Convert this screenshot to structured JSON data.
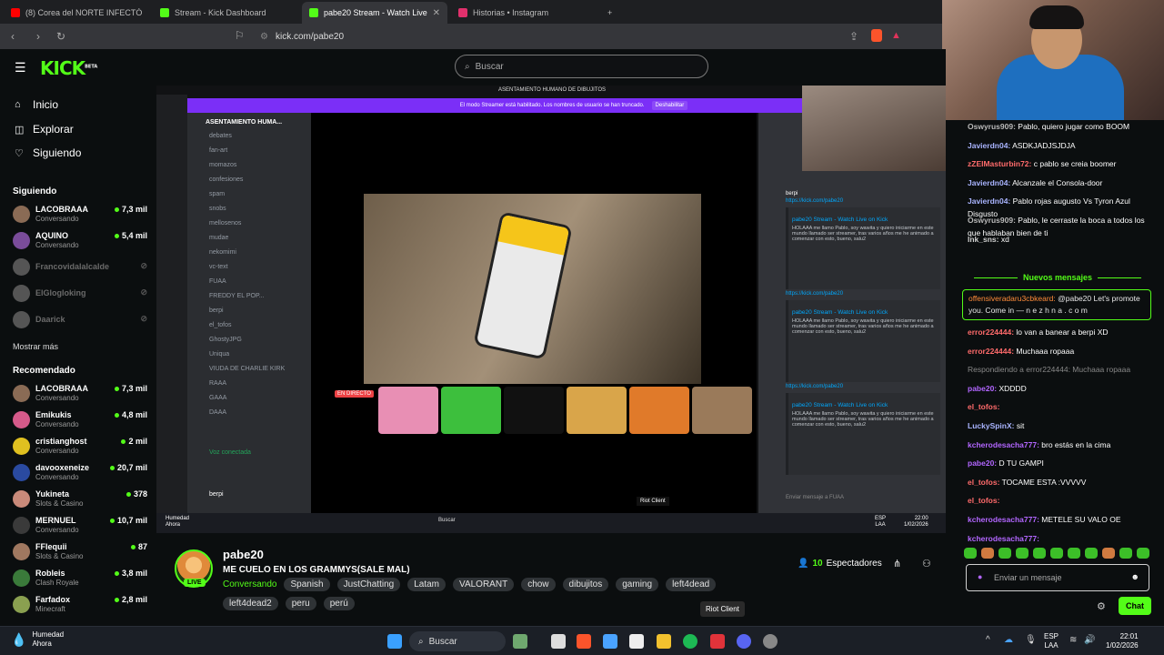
{
  "browser": {
    "tabs": [
      {
        "label": "(8) Corea del NORTE INFECTÓ Play St",
        "color": "#ff0000"
      },
      {
        "label": "Stream - Kick Dashboard",
        "color": "#53fc18"
      },
      {
        "label": "pabe20 Stream - Watch Live o",
        "color": "#53fc18"
      },
      {
        "label": "Historias • Instagram",
        "color": "#e1306c"
      }
    ],
    "new_tab": "+",
    "url": "kick.com/pabe20"
  },
  "kick": {
    "logo": "KICK",
    "logo_beta": "BETA",
    "search_placeholder": "Buscar",
    "nav": [
      {
        "label": "Inicio",
        "icon": "home-icon"
      },
      {
        "label": "Explorar",
        "icon": "compass-icon"
      },
      {
        "label": "Siguiendo",
        "icon": "heart-icon"
      }
    ],
    "following_header": "Siguiendo",
    "following": [
      {
        "name": "LACOBRAAA",
        "category": "Conversando",
        "viewers": "7,3 mil",
        "color": "#8a6b55"
      },
      {
        "name": "AQUINO",
        "category": "Conversando",
        "viewers": "5,4 mil",
        "color": "#7a4c9a"
      },
      {
        "name": "Francovidalalcalde",
        "category": "",
        "viewers": "",
        "color": "#555"
      },
      {
        "name": "ElGlogloking",
        "category": "",
        "viewers": "",
        "color": "#555"
      },
      {
        "name": "Daarick",
        "category": "",
        "viewers": "",
        "color": "#555"
      }
    ],
    "show_more": "Mostrar más",
    "recommended_header": "Recomendado",
    "recommended": [
      {
        "name": "LACOBRAAA",
        "category": "Conversando",
        "viewers": "7,3 mil",
        "color": "#8a6b55"
      },
      {
        "name": "Emikukis",
        "category": "Conversando",
        "viewers": "4,8 mil",
        "color": "#d65a8a"
      },
      {
        "name": "cristianghost",
        "category": "Conversando",
        "viewers": "2 mil",
        "color": "#e0c020"
      },
      {
        "name": "davooxeneize",
        "category": "Conversando",
        "viewers": "20,7 mil",
        "color": "#2a4aa0"
      },
      {
        "name": "Yukineta",
        "category": "Slots & Casino",
        "viewers": "378",
        "color": "#c98a7a"
      },
      {
        "name": "MERNUEL",
        "category": "Conversando",
        "viewers": "10,7 mil",
        "color": "#3a3a3a"
      },
      {
        "name": "FFlequii",
        "category": "Slots & Casino",
        "viewers": "87",
        "color": "#a07860"
      },
      {
        "name": "Robleis",
        "category": "Clash Royale",
        "viewers": "3,8 mil",
        "color": "#3a7a3a"
      },
      {
        "name": "Farfadox",
        "category": "Minecraft",
        "viewers": "2,8 mil",
        "color": "#8aa050"
      }
    ]
  },
  "discord": {
    "banner_title": "ASENTAMIENTO HUMANO DE DIBUJITOS",
    "banner_text": "El modo Streamer está habilitado. Los nombres de usuario se han truncado.",
    "banner_btn": "Deshabilitar",
    "server_name": "ASENTAMIENTO HUMA...",
    "channels": [
      "debates",
      "fan-art",
      "momazos",
      "confesiones",
      "spam",
      "snobs",
      "mellosenos",
      "mudae",
      "nekomimi",
      "vc-text",
      "FUAA",
      "FREDDY EL POP...",
      "berpi",
      "el_tofos",
      "GhostyJPG",
      "Uniqua",
      "VIUDA DE CHARLIE KIRK",
      "RAAA",
      "GAAA",
      "DAAA"
    ],
    "live_label": "EN DIRECTO",
    "voice_connected": "Voz conectada",
    "user": "berpi",
    "chat_channel": "FUAA",
    "embed_author": "berpi",
    "embed_link": "https://kick.com/pabe20",
    "embed_title": "pabe20 Stream - Watch Live on Kick",
    "embed_text": "HOLAAA me llamo Pablo, soy wawita y quiero iniciarme en este mundo llamado ser streamer, tras varios años me he animado a comenzar con esto, bueno, salu2",
    "input_placeholder": "Enviar mensaje a FUAA",
    "tooltip": "Riot Client",
    "taskbar_search": "Buscar",
    "weather_title": "Humedad",
    "weather_sub": "Ahora",
    "lang": "ESP",
    "lang2": "LAA",
    "time": "22:00",
    "date": "1/02/2026"
  },
  "stream": {
    "streamer": "pabe20",
    "live_badge": "LIVE",
    "title": "ME CUELO EN LOS GRAMMYS(SALE MAL)",
    "category": "Conversando",
    "tags": [
      "Spanish",
      "JustChatting",
      "Latam",
      "VALORANT",
      "chow",
      "dibujitos",
      "gaming",
      "left4dead",
      "left4dead2",
      "peru",
      "perú"
    ],
    "viewer_count": "10",
    "viewer_label": "Espectadores",
    "tooltip": "Riot Client"
  },
  "chat": {
    "messages": [
      {
        "user": "Oswyrus909:",
        "text": " Pablo, quiero jugar como BOOM",
        "color": "#b9b9b9"
      },
      {
        "user": "Javierdn04:",
        "text": " ASDKJADJSJDJA",
        "color": "#a9b4ff"
      },
      {
        "user": "zZEIMasturbin72:",
        "text": " c pablo se creia boomer",
        "color": "#ff6b6b"
      },
      {
        "user": "Javierdn04:",
        "text": " Alcanzale el Consola-door",
        "color": "#a9b4ff"
      },
      {
        "user": "Javierdn04:",
        "text": " Pablo rojas augusto Vs Tyron Azul Disgusto",
        "color": "#a9b4ff"
      },
      {
        "user": "Oswyrus909:",
        "text": " Pablo, le cerraste la boca a todos los que hablaban bien de ti",
        "color": "#b9b9b9"
      },
      {
        "user": "Ink_sns:",
        "text": " xd",
        "color": "#d0d0d0"
      }
    ],
    "new_messages": "Nuevos mensajes",
    "pinned": {
      "user": "offensiveradaru3cbkeard:",
      "text": " @pabe20 Let's promote you. Come in — n e z h n a . c o m",
      "color": "#ff8c3a"
    },
    "messages2": [
      {
        "user": "error224444:",
        "text": " lo van a banear a berpi XD",
        "color": "#ff6b6b"
      },
      {
        "user": "error224444:",
        "text": " Muchaaa ropaaa",
        "color": "#ff6b6b"
      },
      {
        "user": "",
        "text": "Respondiendo a error224444: Muchaaa ropaaa",
        "color": "#888"
      },
      {
        "user": "pabe20:",
        "text": " XDDDD",
        "color": "#b266ff"
      },
      {
        "user": "el_tofos:",
        "text": "",
        "color": "#ff6b6b"
      },
      {
        "user": "LuckySpinX:",
        "text": " sit",
        "color": "#a9b4ff"
      },
      {
        "user": "kcherodesacha777:",
        "text": " bro estás en la cima",
        "color": "#b266ff"
      },
      {
        "user": "pabe20:",
        "text": " D TU GAMPI",
        "color": "#b266ff"
      },
      {
        "user": "el_tofos:",
        "text": " TOCAME ESTA :VVVVV",
        "color": "#ff6b6b"
      },
      {
        "user": "el_tofos:",
        "text": "",
        "color": "#ff6b6b"
      },
      {
        "user": "kcherodesacha777:",
        "text": " METELE SU VALO OE",
        "color": "#b266ff"
      },
      {
        "user": "kcherodesacha777:",
        "text": "",
        "color": "#b266ff"
      }
    ],
    "input_placeholder": "Enviar un mensaje",
    "send_label": "Chat"
  },
  "taskbar": {
    "weather_title": "Humedad",
    "weather_sub": "Ahora",
    "search": "Buscar",
    "lang": "ESP",
    "lang2": "LAA",
    "time": "22:01",
    "date": "1/02/2026"
  }
}
